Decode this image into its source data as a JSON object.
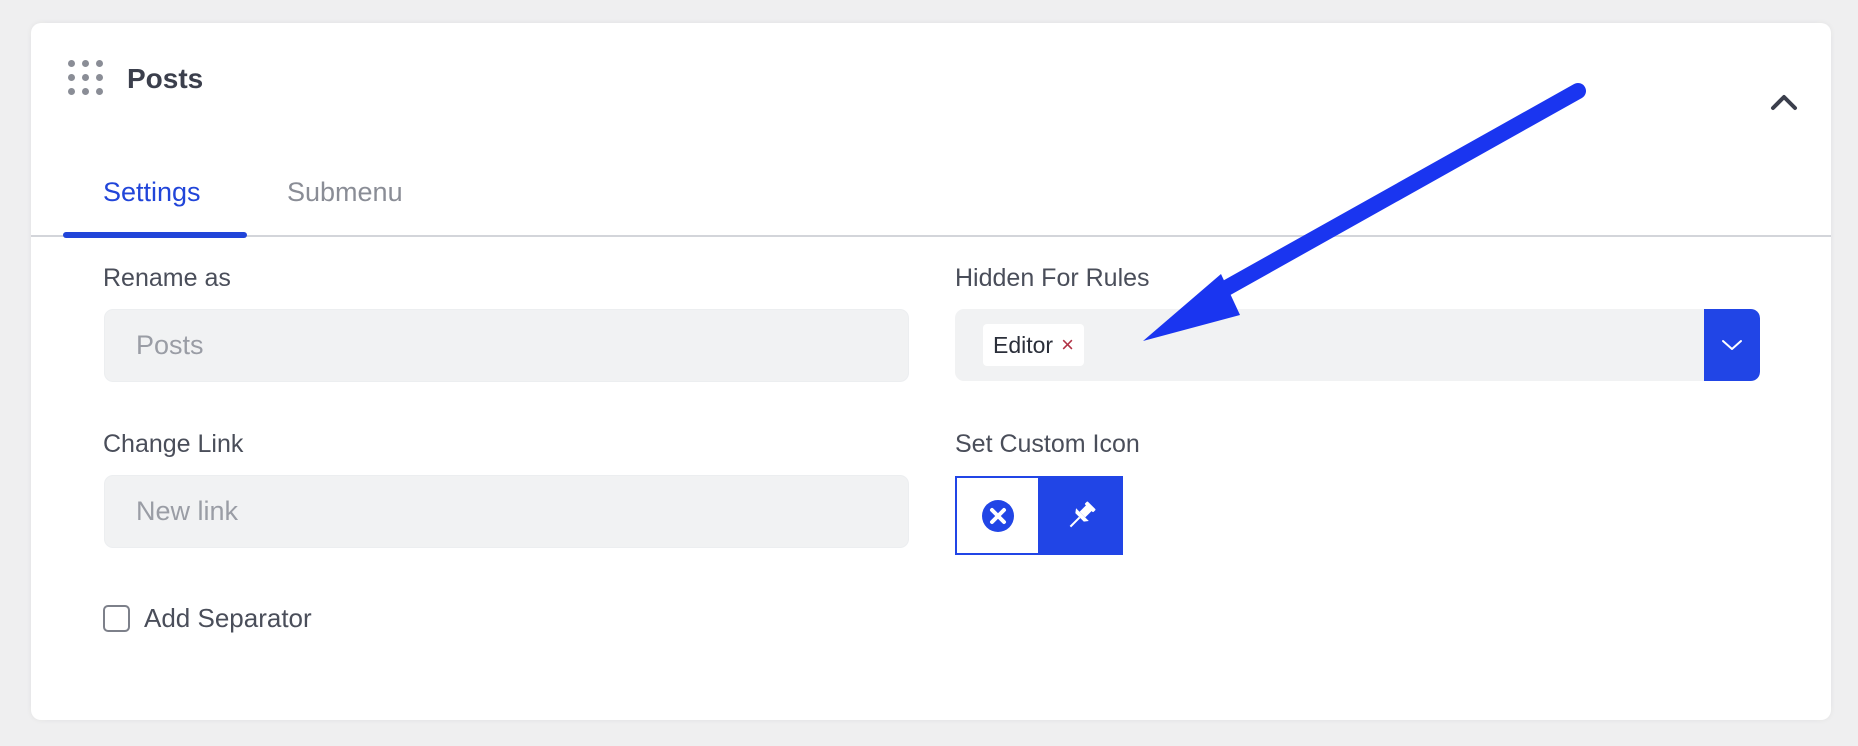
{
  "panel": {
    "title": "Posts",
    "drag_icon": "drag-dots-icon",
    "collapse_icon": "chevron-up-icon"
  },
  "tabs": [
    {
      "label": "Settings",
      "active": true
    },
    {
      "label": "Submenu",
      "active": false
    }
  ],
  "form": {
    "rename_label": "Rename as",
    "rename_placeholder": "Posts",
    "rename_value": "",
    "link_label": "Change Link",
    "link_placeholder": "New link",
    "link_value": "",
    "hidden_label": "Hidden For Rules",
    "hidden_selected": [
      {
        "label": "Editor",
        "remove": "×"
      }
    ],
    "hidden_toggle_icon": "chevron-down-icon",
    "icon_label": "Set Custom Icon",
    "icon_clear_icon": "close-circle-icon",
    "icon_pick_icon": "pin-icon",
    "separator_label": "Add Separator",
    "separator_checked": false
  },
  "annotation": {
    "arrow_color": "#1a35f0"
  },
  "colors": {
    "accent": "#2145e6",
    "tab_active": "#2145d9",
    "background": "#efeff0"
  }
}
